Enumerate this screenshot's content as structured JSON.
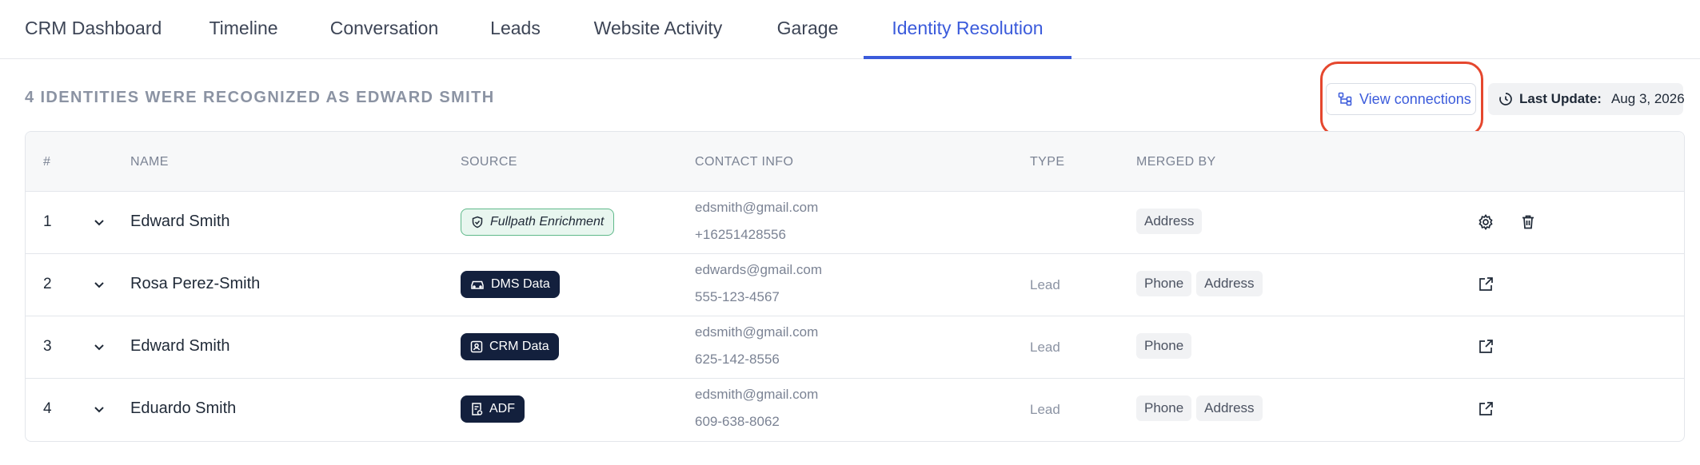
{
  "tabs": [
    {
      "label": "CRM Dashboard"
    },
    {
      "label": "Timeline"
    },
    {
      "label": "Conversation"
    },
    {
      "label": "Leads"
    },
    {
      "label": "Website Activity"
    },
    {
      "label": "Garage"
    },
    {
      "label": "Identity Resolution",
      "active": true
    }
  ],
  "summary": "4 IDENTITIES WERE RECOGNIZED AS EDWARD SMITH",
  "view_connections": {
    "label": "View connections",
    "icon": "connections-icon"
  },
  "last_update": {
    "label": "Last Update:",
    "value": "Aug 3, 2026",
    "icon": "clock-icon"
  },
  "colors": {
    "accent": "#3b5bdb",
    "highlight": "#e5472e",
    "badge_dark": "#13203d",
    "badge_enrich": "#e8f6ef"
  },
  "table": {
    "headers": [
      "#",
      "NAME",
      "SOURCE",
      "CONTACT INFO",
      "TYPE",
      "MERGED BY"
    ],
    "rows": [
      {
        "num": "1",
        "name": "Edward Smith",
        "source": "Fullpath Enrichment",
        "source_icon": "shield-check-icon",
        "email": "edsmith@gmail.com",
        "phone": "+16251428556",
        "type": "",
        "merged_by": [
          "Address"
        ],
        "actions": [
          "settings-icon",
          "trash-icon"
        ]
      },
      {
        "num": "2",
        "name": "Rosa Perez-Smith",
        "source": "DMS Data",
        "source_icon": "car-icon",
        "email": "edwards@gmail.com",
        "phone": "555-123-4567",
        "type": "Lead",
        "merged_by": [
          "Phone",
          "Address"
        ],
        "actions": [
          "external-link-icon"
        ]
      },
      {
        "num": "3",
        "name": "Edward Smith",
        "source": "CRM Data",
        "source_icon": "contact-card-icon",
        "email": "edsmith@gmail.com",
        "phone": "625-142-8556",
        "type": "Lead",
        "merged_by": [
          "Phone"
        ],
        "actions": [
          "external-link-icon"
        ]
      },
      {
        "num": "4",
        "name": "Eduardo Smith",
        "source": "ADF",
        "source_icon": "document-icon",
        "email": "edsmith@gmail.com",
        "phone": "609-638-8062",
        "type": "Lead",
        "merged_by": [
          "Phone",
          "Address"
        ],
        "actions": [
          "external-link-icon"
        ]
      }
    ]
  }
}
